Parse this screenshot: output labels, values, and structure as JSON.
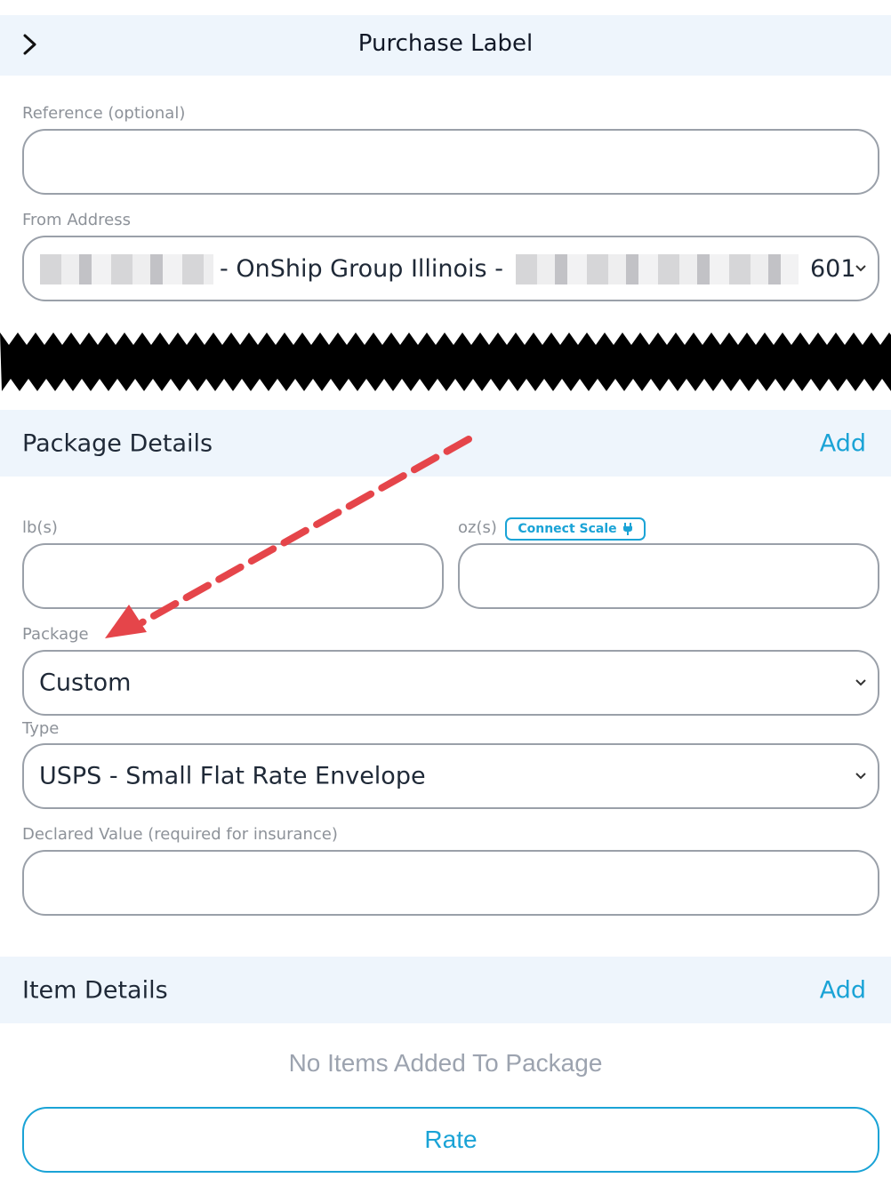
{
  "header": {
    "title": "Purchase Label"
  },
  "reference": {
    "label": "Reference (optional)",
    "value": ""
  },
  "from_address": {
    "label": "From Address",
    "value_middle": "- OnShip Group Illinois -",
    "value_tail": "601"
  },
  "package_details": {
    "title": "Package Details",
    "add_label": "Add",
    "lbs_label": "lb(s)",
    "oz_label": "oz(s)",
    "connect_scale_label": "Connect Scale",
    "package_label": "Package",
    "package_value": "Custom",
    "type_label": "Type",
    "type_value": "USPS - Small Flat Rate Envelope",
    "declared_label": "Declared Value (required for insurance)"
  },
  "item_details": {
    "title": "Item Details",
    "add_label": "Add",
    "empty_message": "No Items Added To Package"
  },
  "actions": {
    "rate_label": "Rate"
  },
  "colors": {
    "accent": "#1aa3d6",
    "section_bg": "#eef5fc",
    "annotation_arrow": "#e53e3e"
  }
}
